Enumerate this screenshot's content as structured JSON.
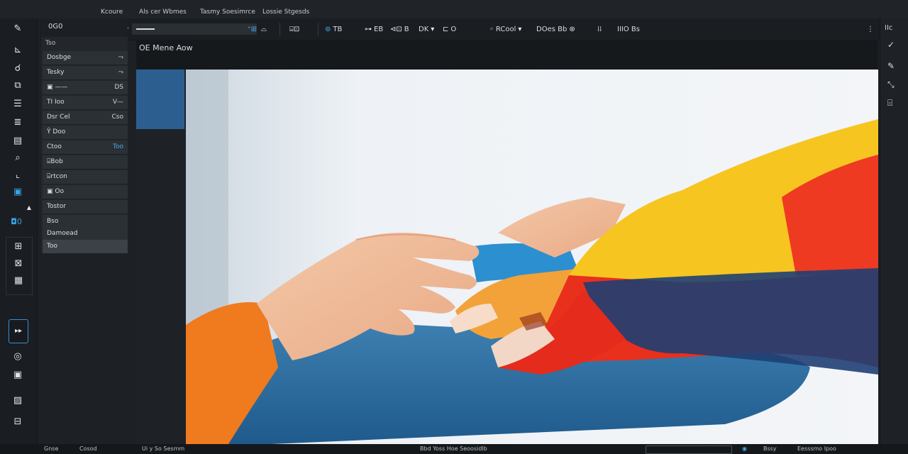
{
  "menubar": {
    "items": [
      "Kcoure",
      "Als cer Wbmes",
      "Tasmy Soesimrce",
      "Lossie Stgesds"
    ]
  },
  "toolbar": {
    "preset_label": "0G0",
    "zoom_value": "",
    "items": {
      "t1": "TB",
      "t2": "EB",
      "t3": "B",
      "t4": "DK",
      "t5": "O",
      "t6": "RCool",
      "t7": "DOes Bb",
      "t8": "IIIO Bs"
    },
    "icons": [
      "pointer-icon",
      "crop-icon",
      "eye-icon",
      "frame-icon",
      "link-icon",
      "node-icon",
      "grid-icon"
    ]
  },
  "left_tools": {
    "play_label": "▸▸",
    "zoom_label": "0"
  },
  "layers_panel": {
    "header": "Ts0",
    "title": "Tso",
    "rows": [
      {
        "label": "Dosbge",
        "value": "⤳"
      },
      {
        "label": "Tesky",
        "value": "⤳"
      },
      {
        "label": "▣ ——",
        "value": "DS"
      },
      {
        "label": "TI Ioo",
        "value": "V—"
      },
      {
        "label": "Dsr Cel",
        "value": "Cso"
      },
      {
        "label": "Ŷ Doo",
        "value": ""
      },
      {
        "label": "Ctoo",
        "value": "Too"
      },
      {
        "label": "⌸Bob",
        "value": ""
      },
      {
        "label": "⌸rtcon",
        "value": ""
      },
      {
        "label": "▣ Oo",
        "value": ""
      },
      {
        "label": "Tostor",
        "value": ""
      },
      {
        "label": "Bso",
        "value": ""
      },
      {
        "label": "Damoead",
        "value": ""
      },
      {
        "label": "Too",
        "value": ""
      }
    ]
  },
  "document": {
    "tab_title": "OE Mene Aow"
  },
  "right_rail": {
    "label": "IIc"
  },
  "status": {
    "left1": "Gnse",
    "left2": "Cosod",
    "left3": "Ui y So Sesmm",
    "mid": "Bbd Yoss Hoe Seoosidlb",
    "right1": "Bssy",
    "right2": "Eesssmo Ipoo"
  },
  "colors": {
    "accent": "#3aa2e6",
    "panel": "#23272c",
    "selected_row": "#3b4147",
    "swatch": "#2c5f8f"
  }
}
